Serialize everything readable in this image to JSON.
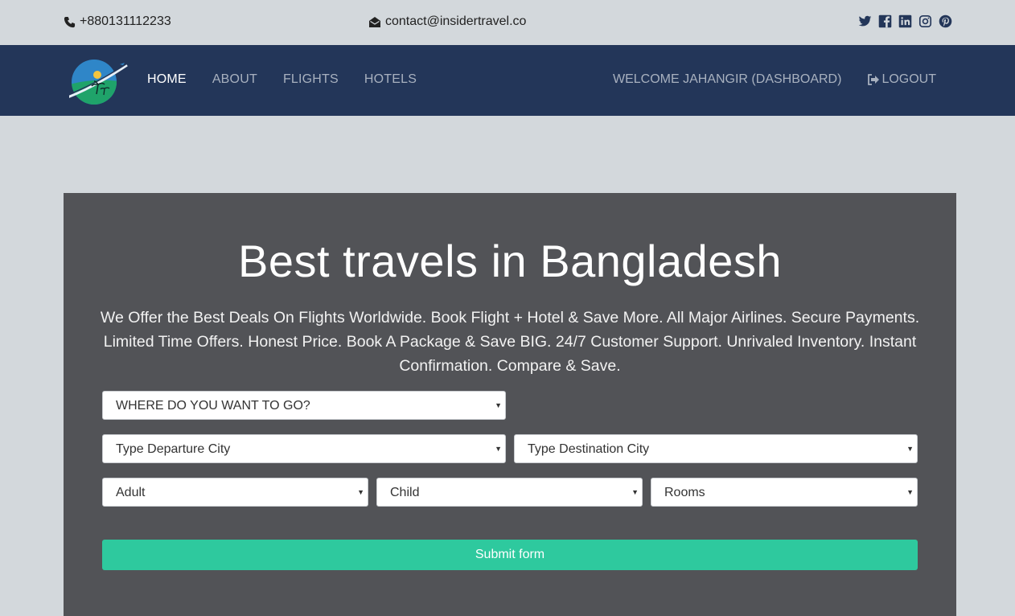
{
  "topbar": {
    "phone": "+880131112233",
    "email": "contact@insidertravel.co",
    "social_icons": [
      "twitter-icon",
      "facebook-icon",
      "linkedin-icon",
      "instagram-icon",
      "pinterest-icon"
    ]
  },
  "nav": {
    "items": [
      {
        "label": "HOME"
      },
      {
        "label": "ABOUT"
      },
      {
        "label": "FLIGHTS"
      },
      {
        "label": "HOTELS"
      }
    ],
    "welcome": "WELCOME JAHANGIR (DASHBOARD)",
    "logout": "LOGOUT"
  },
  "hero": {
    "title": "Best travels in Bangladesh",
    "description": "We Offer the Best Deals On Flights Worldwide. Book Flight + Hotel & Save More. All Major Airlines. Secure Payments. Limited Time Offers. Honest Price. Book A Package & Save BIG. 24/7 Customer Support. Unrivaled Inventory. Instant Confirmation. Compare & Save."
  },
  "form": {
    "destination": "WHERE DO YOU WANT TO GO?",
    "departure": "Type Departure City",
    "arrival": "Type Destination City",
    "adult": "Adult",
    "child": "Child",
    "rooms": "Rooms",
    "submit": "Submit form"
  },
  "colors": {
    "navbar": "#233659",
    "hero_bg": "#525357",
    "accent": "#2ec99e",
    "page_bg": "#d3d8dc"
  }
}
